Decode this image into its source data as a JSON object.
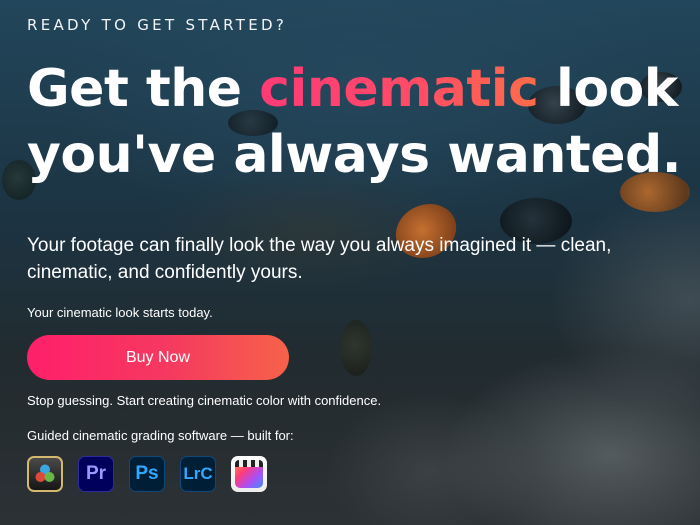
{
  "hero": {
    "eyebrow": "READY TO GET STARTED?",
    "headline": {
      "line1_prefix": "Get the",
      "line1_accent": "cinematic",
      "line1_suffix": "look",
      "line2": "you've always wanted."
    },
    "subhead": "Your footage can finally look the way you always imagined it — clean, cinematic, and confidently yours.",
    "tagline": "Your cinematic look starts today.",
    "cta_label": "Buy Now",
    "stop_text": "Stop guessing. Start creating cinematic color with confidence.",
    "guided_text": "Guided cinematic grading software — built for:"
  },
  "apps": {
    "davinci": {
      "icon": "davinci-resolve-icon"
    },
    "premiere": {
      "icon": "premiere-pro-icon",
      "label": "Pr"
    },
    "photoshop": {
      "icon": "photoshop-icon",
      "label": "Ps"
    },
    "lightroom": {
      "icon": "lightroom-classic-icon",
      "label": "LrC"
    },
    "finalcut": {
      "icon": "final-cut-pro-icon"
    }
  },
  "colors": {
    "accent_start": "#ff1f6b",
    "accent_end": "#f66249",
    "text": "#ffffff"
  }
}
